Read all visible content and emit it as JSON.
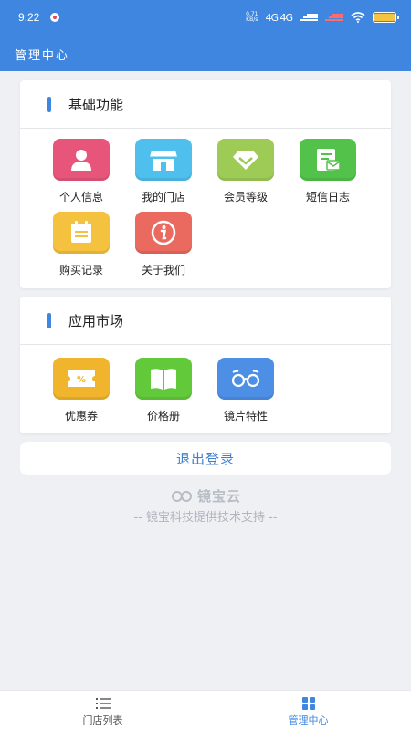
{
  "status_bar": {
    "time": "9:22",
    "speed_value": "0.71",
    "speed_unit": "KB/s",
    "signal": "4G 4G"
  },
  "header": {
    "title": "管理中心"
  },
  "basic": {
    "title": "基础功能",
    "items": [
      {
        "label": "个人信息",
        "icon": "user-icon",
        "color": "#e8557a"
      },
      {
        "label": "我的门店",
        "icon": "store-icon",
        "color": "#4fc0ee"
      },
      {
        "label": "会员等级",
        "icon": "diamond-icon",
        "color": "#9dcb55"
      },
      {
        "label": "短信日志",
        "icon": "message-log-icon",
        "color": "#52c24a"
      },
      {
        "label": "购买记录",
        "icon": "calendar-icon",
        "color": "#f5c23f"
      },
      {
        "label": "关于我们",
        "icon": "info-icon",
        "color": "#ea6a60"
      }
    ]
  },
  "market": {
    "title": "应用市场",
    "items": [
      {
        "label": "优惠券",
        "icon": "coupon-icon",
        "color": "#f0b52c"
      },
      {
        "label": "价格册",
        "icon": "book-icon",
        "color": "#62c93a"
      },
      {
        "label": "镜片特性",
        "icon": "glasses-icon",
        "color": "#4e8fe6"
      }
    ]
  },
  "logout_label": "退出登录",
  "brand_name": "镜宝云",
  "support_text": "-- 镜宝科技提供技术支持 --",
  "tabs": [
    {
      "label": "门店列表",
      "icon": "list-icon",
      "active": false
    },
    {
      "label": "管理中心",
      "icon": "grid-icon",
      "active": true
    }
  ],
  "colors": {
    "primary": "#3f86e0",
    "background": "#eef0f4"
  }
}
